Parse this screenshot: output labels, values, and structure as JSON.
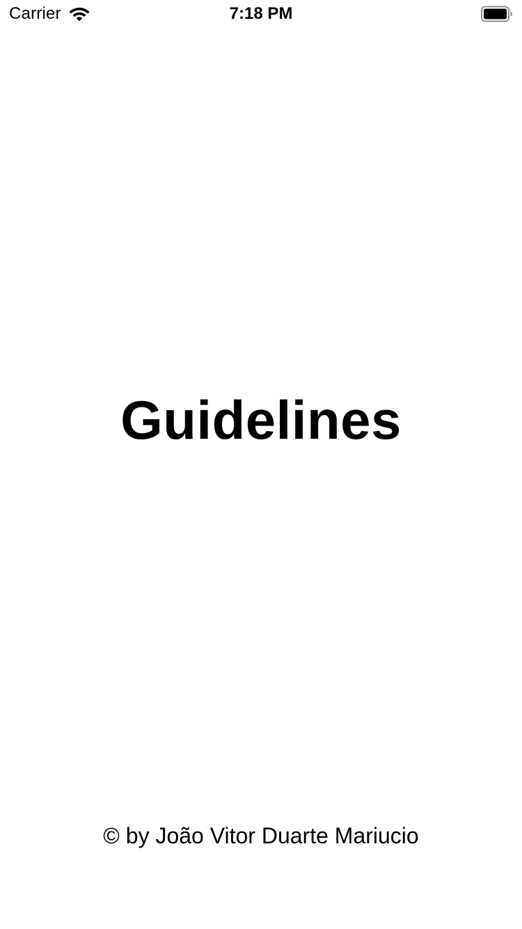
{
  "status_bar": {
    "carrier": "Carrier",
    "time": "7:18 PM",
    "wifi_icon": "wifi-icon",
    "battery_icon": "battery-icon"
  },
  "main": {
    "title": "Guidelines"
  },
  "footer": {
    "credit": "© by João Vitor Duarte Mariucio"
  },
  "colors": {
    "background": "#ffffff",
    "text": "#000000"
  }
}
